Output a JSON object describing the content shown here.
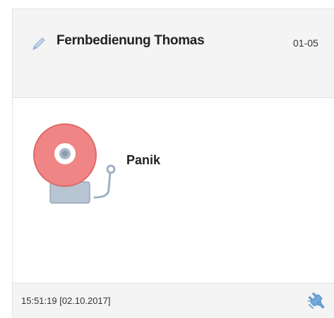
{
  "card": {
    "title": "Fernbedienung Thomas",
    "device_id": "01-05",
    "edit_icon": "pencil-icon",
    "alarm": {
      "icon": "alarm-bell-icon",
      "label": "Panik",
      "bell_color": "#f08080",
      "base_color": "#a9b9c9"
    },
    "footer": {
      "timestamp": "15:51:19 [02.10.2017]",
      "status_icon": "plug-icon",
      "status_icon_color": "#6fa8dc"
    }
  }
}
